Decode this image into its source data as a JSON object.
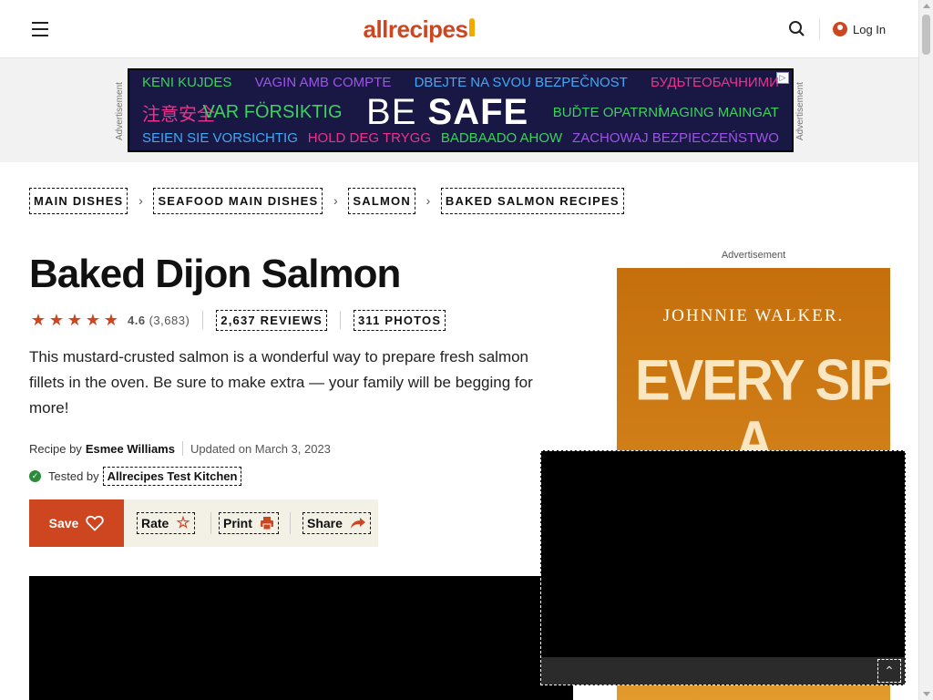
{
  "header": {
    "logo_text": "allrecipes",
    "login_label": "Log In",
    "icons": {
      "menu": "hamburger-menu-icon",
      "search": "search-icon",
      "user": "user-icon"
    }
  },
  "top_ad": {
    "side_label": "Advertisement",
    "row1": [
      "KENI KUJDES",
      "VAGIN AMB COMPTE",
      "DBEJTE NA SVOU BEZPEČNOST",
      "БУДЬТЕОБАЧНИМИ"
    ],
    "row2_left": [
      "注意安全",
      "VAR FÖRSIKTIG"
    ],
    "row2_big_a": "BE",
    "row2_big_b": "SAFE",
    "row2_right": [
      "BUĎTE OPATRNÍ",
      "MAGING MAINGAT"
    ],
    "row3": [
      "SEIEN SIE VORSICHTIG",
      "HOLD DEG TRYGG",
      "BADBAADO AHOW",
      "ZACHOWAJ BEZPIECZEŃSTWO"
    ],
    "colors": {
      "bg": "#191845",
      "green": "#3bd15c",
      "purple": "#9b55e6",
      "blue": "#3fa9f5",
      "pink": "#e8348d"
    }
  },
  "breadcrumbs": [
    "MAIN DISHES",
    "SEAFOOD MAIN DISHES",
    "SALMON",
    "BAKED SALMON RECIPES"
  ],
  "recipe": {
    "title": "Baked Dijon Salmon",
    "rating_value": "4.6",
    "rating_count": "(3,683)",
    "stars_filled": 4.5,
    "reviews_label": "2,637 REVIEWS",
    "photos_label": "311 PHOTOS",
    "description": "This mustard-crusted salmon is a wonderful way to prepare fresh salmon fillets in the oven. Be sure to make extra — your family will be begging for more!",
    "recipe_by_label": "Recipe by",
    "author": "Esmee Williams",
    "updated": "Updated on March 3, 2023",
    "tested_by_label": "Tested by",
    "tested_by": "Allrecipes Test Kitchen"
  },
  "actions": {
    "save": "Save",
    "rate": "Rate",
    "print": "Print",
    "share": "Share"
  },
  "side_ad": {
    "label": "Advertisement",
    "brand": "JOHNNIE WALKER.",
    "headline_1": "EVERY SIP",
    "headline_2": "A STORY"
  },
  "colors": {
    "brand": "#ce4620",
    "action_bar": "#f3f1e6",
    "verified": "#2c8a3a"
  }
}
